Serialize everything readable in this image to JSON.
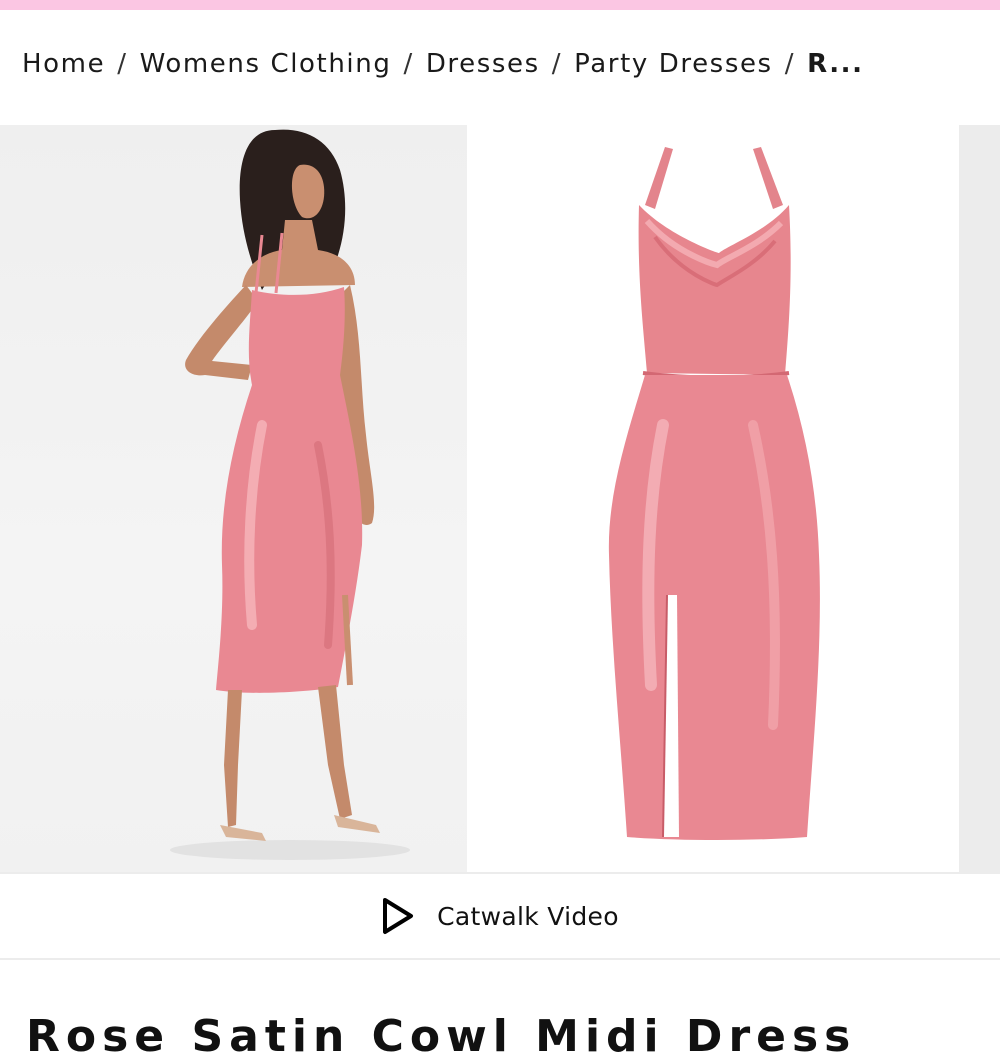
{
  "colors": {
    "brand_top_bar": "#fbc6e3",
    "dress_pink": "#e9878f",
    "text": "#111111"
  },
  "breadcrumb": [
    {
      "label": "Home"
    },
    {
      "label": "Womens Clothing"
    },
    {
      "label": "Dresses"
    },
    {
      "label": "Party Dresses"
    },
    {
      "label": "R..."
    }
  ],
  "breadcrumb_separator": "/",
  "gallery": {
    "images": [
      {
        "name": "model-photo"
      },
      {
        "name": "product-photo"
      },
      {
        "name": "next-photo-peek"
      }
    ]
  },
  "share": {
    "icon": "share-icon"
  },
  "video": {
    "icon": "play-icon",
    "label": "Catwalk Video"
  },
  "product": {
    "title": "Rose Satin Cowl Midi Dress"
  }
}
